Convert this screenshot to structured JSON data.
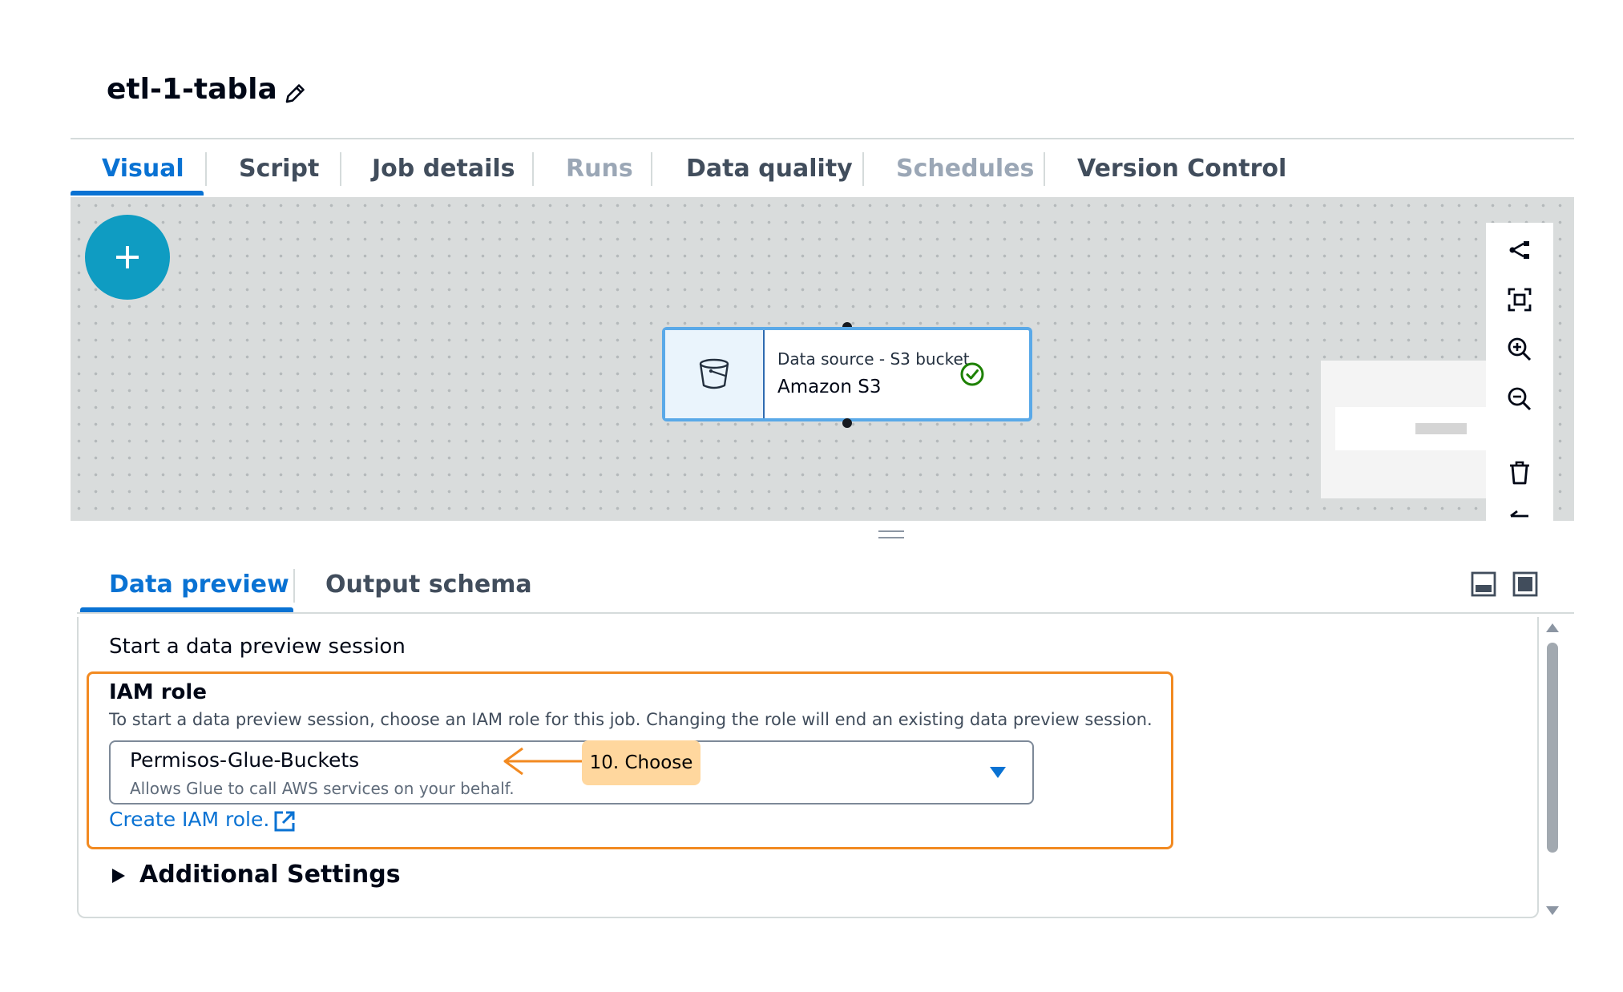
{
  "job": {
    "title": "etl-1-tabla"
  },
  "tabs": [
    {
      "label": "Visual",
      "state": "active"
    },
    {
      "label": "Script",
      "state": "enabled"
    },
    {
      "label": "Job details",
      "state": "enabled"
    },
    {
      "label": "Runs",
      "state": "disabled"
    },
    {
      "label": "Data quality",
      "state": "enabled"
    },
    {
      "label": "Schedules",
      "state": "disabled"
    },
    {
      "label": "Version Control",
      "state": "enabled"
    }
  ],
  "canvas": {
    "add_button_icon": "plus-icon",
    "node": {
      "type_label": "Data source - S3 bucket",
      "name": "Amazon S3",
      "icon": "s3-bucket-icon",
      "status_icon": "check-circle-icon",
      "status_color": "#1d8102"
    },
    "toolbar_icons": [
      "layout-icon",
      "fit-view-icon",
      "zoom-in-icon",
      "zoom-out-icon",
      "delete-icon",
      "undo-icon"
    ]
  },
  "panel": {
    "tabs": [
      {
        "label": "Data preview",
        "state": "active"
      },
      {
        "label": "Output schema",
        "state": "enabled"
      }
    ],
    "heading": "Start a data preview session",
    "iam": {
      "label": "IAM role",
      "description": "To start a data preview session, choose an IAM role for this job. Changing the role will end an existing data preview session.",
      "selected_value": "Permisos-Glue-Buckets",
      "selected_description": "Allows Glue to call AWS services on your behalf.",
      "create_link": "Create IAM role."
    },
    "additional_settings": "Additional Settings",
    "expanded": false
  },
  "annotation": {
    "label": "10. Choose",
    "color": "#ffd79e",
    "highlight_color": "#f28a21"
  },
  "colors": {
    "accent": "#0972d3",
    "canvas_bg": "#d9dcdc",
    "add_button": "#0f9cc2"
  }
}
